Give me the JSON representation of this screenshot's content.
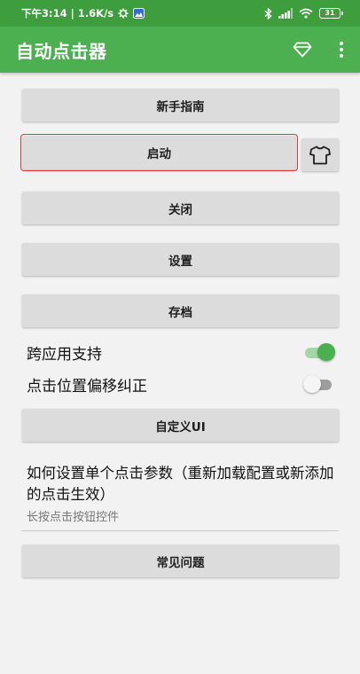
{
  "status_bar": {
    "time_speed": "下午3:14 | 1.6K/s",
    "battery": "31"
  },
  "app_bar": {
    "title": "自动点击器"
  },
  "buttons": {
    "guide": "新手指南",
    "start": "启动",
    "close": "关闭",
    "settings": "设置",
    "archive": "存档",
    "custom_ui": "自定义UI",
    "faq": "常见问题"
  },
  "toggles": [
    {
      "label": "跨应用支持",
      "state": "on"
    },
    {
      "label": "点击位置偏移纠正",
      "state": "off"
    }
  ],
  "pref": {
    "title": "如何设置单个点击参数（重新加载配置或新添加的点击生效）",
    "summary": "长按点击按钮控件"
  },
  "colors": {
    "status_bar": "#3e9e3e",
    "app_bar": "#4caf50",
    "accent": "#4caf50",
    "focus_outline": "#e53935",
    "button_bg": "#dcdcdc"
  },
  "icons": [
    "settings-gear-icon",
    "image-notification-icon",
    "bluetooth-icon",
    "signal-icon",
    "wifi-icon",
    "battery-icon",
    "diamond-icon",
    "more-vert-icon",
    "shirt-icon"
  ]
}
